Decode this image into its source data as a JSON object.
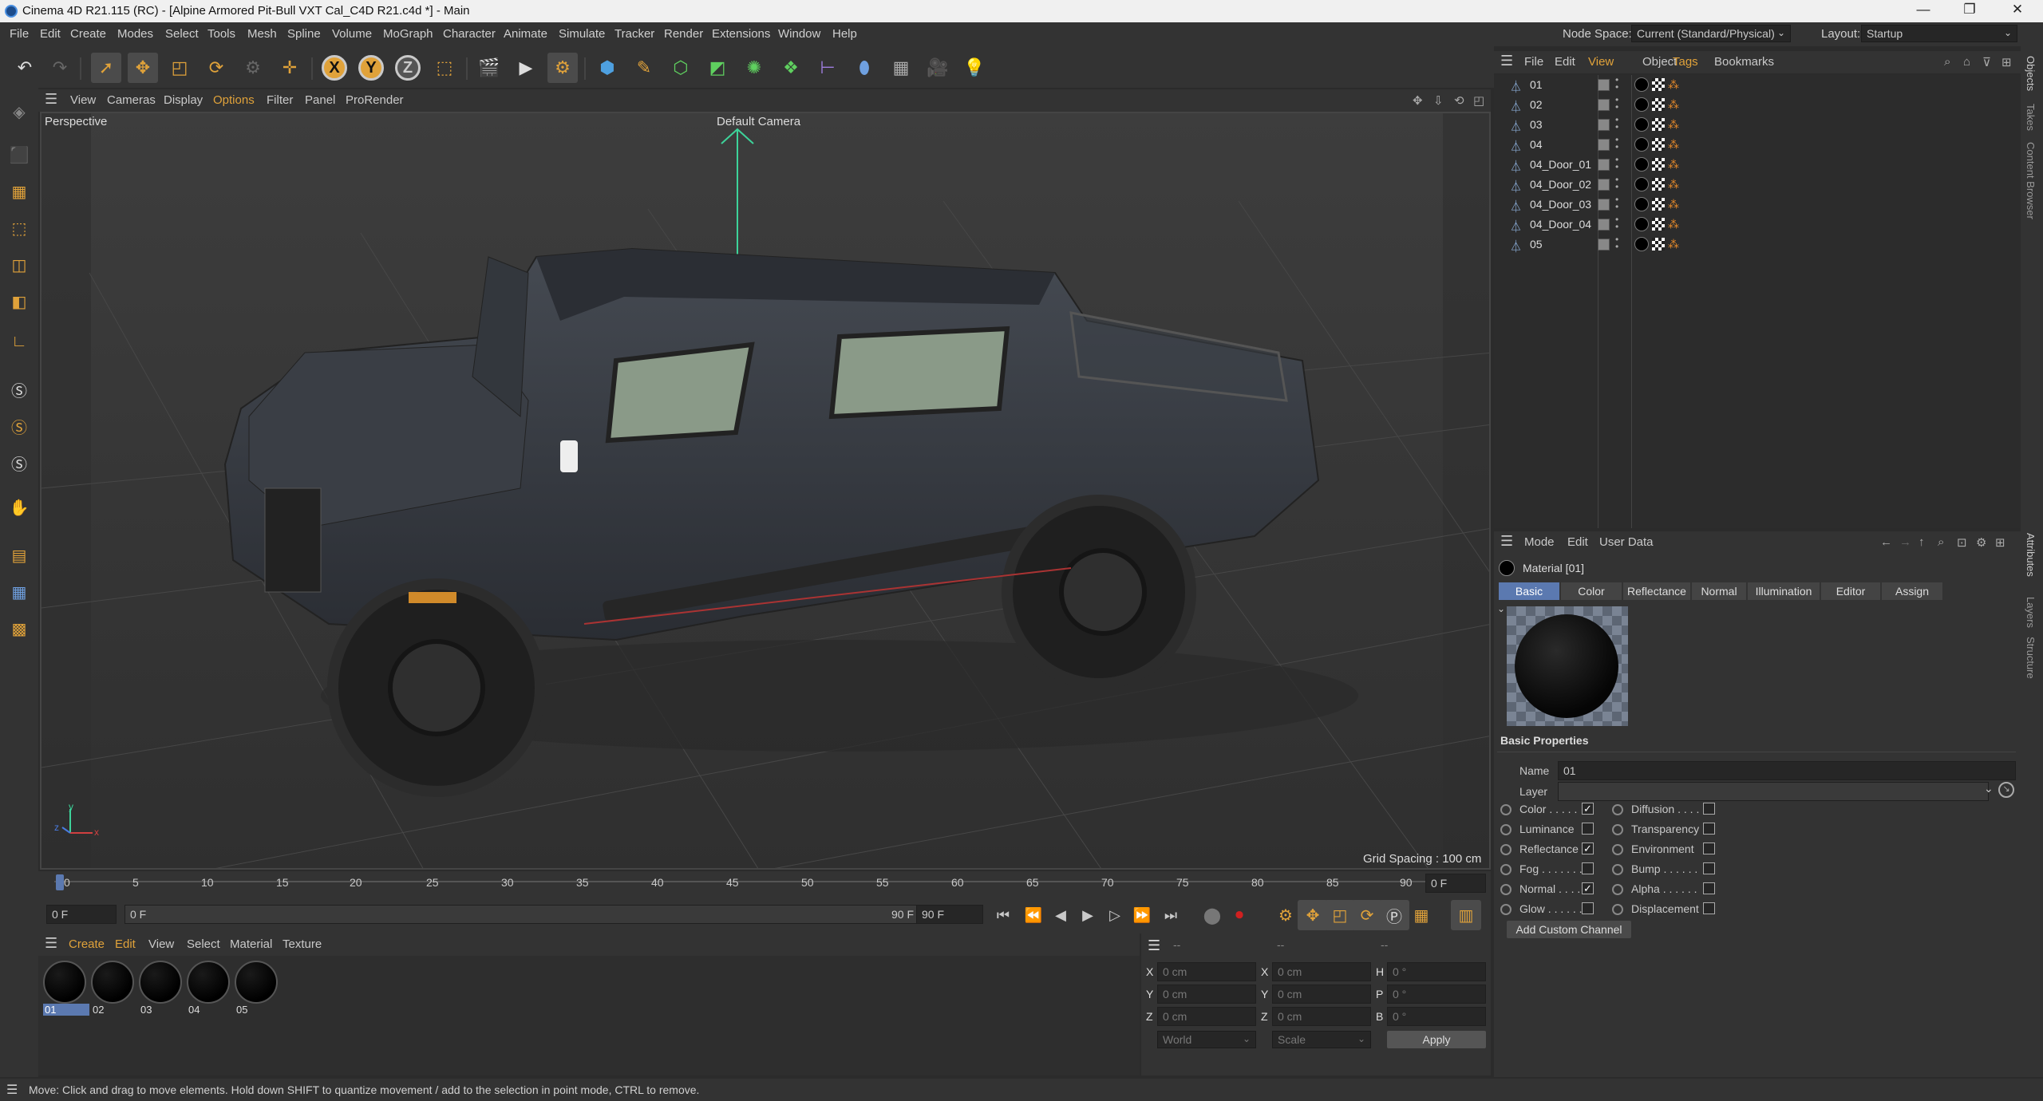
{
  "window": {
    "title": "Cinema 4D R21.115 (RC) - [Alpine Armored Pit-Bull VXT Cal_C4D R21.c4d *] - Main",
    "minimize": "—",
    "maximize": "❐",
    "close": "✕"
  },
  "menubar": {
    "items": [
      "File",
      "Edit",
      "Create",
      "Modes",
      "Select",
      "Tools",
      "Mesh",
      "Spline",
      "Volume",
      "MoGraph",
      "Character",
      "Animate",
      "Simulate",
      "Tracker",
      "Render",
      "Extensions",
      "Window",
      "Help"
    ],
    "node_space_label": "Node Space:",
    "node_space_value": "Current (Standard/Physical)",
    "layout_label": "Layout:",
    "layout_value": "Startup"
  },
  "toolbar": {
    "axes": [
      "X",
      "Y",
      "Z"
    ]
  },
  "viewport": {
    "menu": [
      "View",
      "Cameras",
      "Display",
      "Options",
      "Filter",
      "Panel",
      "ProRender"
    ],
    "name": "Perspective",
    "camera": "Default Camera",
    "grid_spacing": "Grid Spacing : 100 cm",
    "axis_labels": {
      "x": "x",
      "y": "y",
      "z": "z"
    }
  },
  "timeline": {
    "ticks": [
      "0",
      "5",
      "10",
      "15",
      "20",
      "25",
      "30",
      "35",
      "40",
      "45",
      "50",
      "55",
      "60",
      "65",
      "70",
      "75",
      "80",
      "85",
      "90"
    ],
    "current_frame": "0 F",
    "start_field": "0 F",
    "range_start": "0 F",
    "range_end": "90 F",
    "end_field": "90 F"
  },
  "material_manager": {
    "menu": [
      "Create",
      "Edit",
      "View",
      "Select",
      "Material",
      "Texture"
    ],
    "materials": [
      {
        "name": "01",
        "selected": true
      },
      {
        "name": "02",
        "selected": false
      },
      {
        "name": "03",
        "selected": false
      },
      {
        "name": "04",
        "selected": false
      },
      {
        "name": "05",
        "selected": false
      }
    ]
  },
  "coordinates": {
    "header": [
      "--",
      "--",
      "--"
    ],
    "rows": [
      {
        "a": "X",
        "av": "0 cm",
        "b": "X",
        "bv": "0 cm",
        "c": "H",
        "cv": "0 °"
      },
      {
        "a": "Y",
        "av": "0 cm",
        "b": "Y",
        "bv": "0 cm",
        "c": "P",
        "cv": "0 °"
      },
      {
        "a": "Z",
        "av": "0 cm",
        "b": "Z",
        "bv": "0 cm",
        "c": "B",
        "cv": "0 °"
      }
    ],
    "space": "World",
    "mode": "Scale",
    "apply": "Apply"
  },
  "status": {
    "message": "Move: Click and drag to move elements. Hold down SHIFT to quantize movement / add to the selection in point mode, CTRL to remove."
  },
  "object_manager": {
    "menu": [
      "File",
      "Edit",
      "View",
      "Object",
      "Tags",
      "Bookmarks"
    ],
    "objects": [
      "01",
      "02",
      "03",
      "04",
      "04_Door_01",
      "04_Door_02",
      "04_Door_03",
      "04_Door_04",
      "05"
    ]
  },
  "attributes": {
    "menu": [
      "Mode",
      "Edit",
      "User Data"
    ],
    "title": "Material [01]",
    "tabs": [
      "Basic",
      "Color",
      "Reflectance",
      "Normal",
      "Illumination",
      "Editor",
      "Assign"
    ],
    "active_tab": "Basic",
    "section": "Basic Properties",
    "name_label": "Name",
    "name_value": "01",
    "layer_label": "Layer",
    "channels_left": [
      {
        "label": "Color . . . . .",
        "checked": true
      },
      {
        "label": "Luminance",
        "checked": false
      },
      {
        "label": "Reflectance",
        "checked": true
      },
      {
        "label": "Fog . . . . . . .",
        "checked": false
      },
      {
        "label": "Normal . . . .",
        "checked": true
      },
      {
        "label": "Glow . . . . . .",
        "checked": false
      }
    ],
    "channels_right": [
      {
        "label": "Diffusion . . . .",
        "checked": false
      },
      {
        "label": "Transparency",
        "checked": false
      },
      {
        "label": "Environment",
        "checked": false
      },
      {
        "label": "Bump . . . . . .",
        "checked": false
      },
      {
        "label": "Alpha . . . . . .",
        "checked": false
      },
      {
        "label": "Displacement",
        "checked": false
      }
    ],
    "add_channel": "Add Custom Channel"
  },
  "right_rail": {
    "tabs_top": [
      "Objects",
      "Takes",
      "Content Browser"
    ],
    "tabs_bottom": [
      "Attributes",
      "Layers",
      "Structure"
    ]
  },
  "colors": {
    "accent": "#5b79b0",
    "options_menu": "#e0a23a",
    "tags_menu": "#e0a23a",
    "view_menu": "#e0a23a"
  }
}
